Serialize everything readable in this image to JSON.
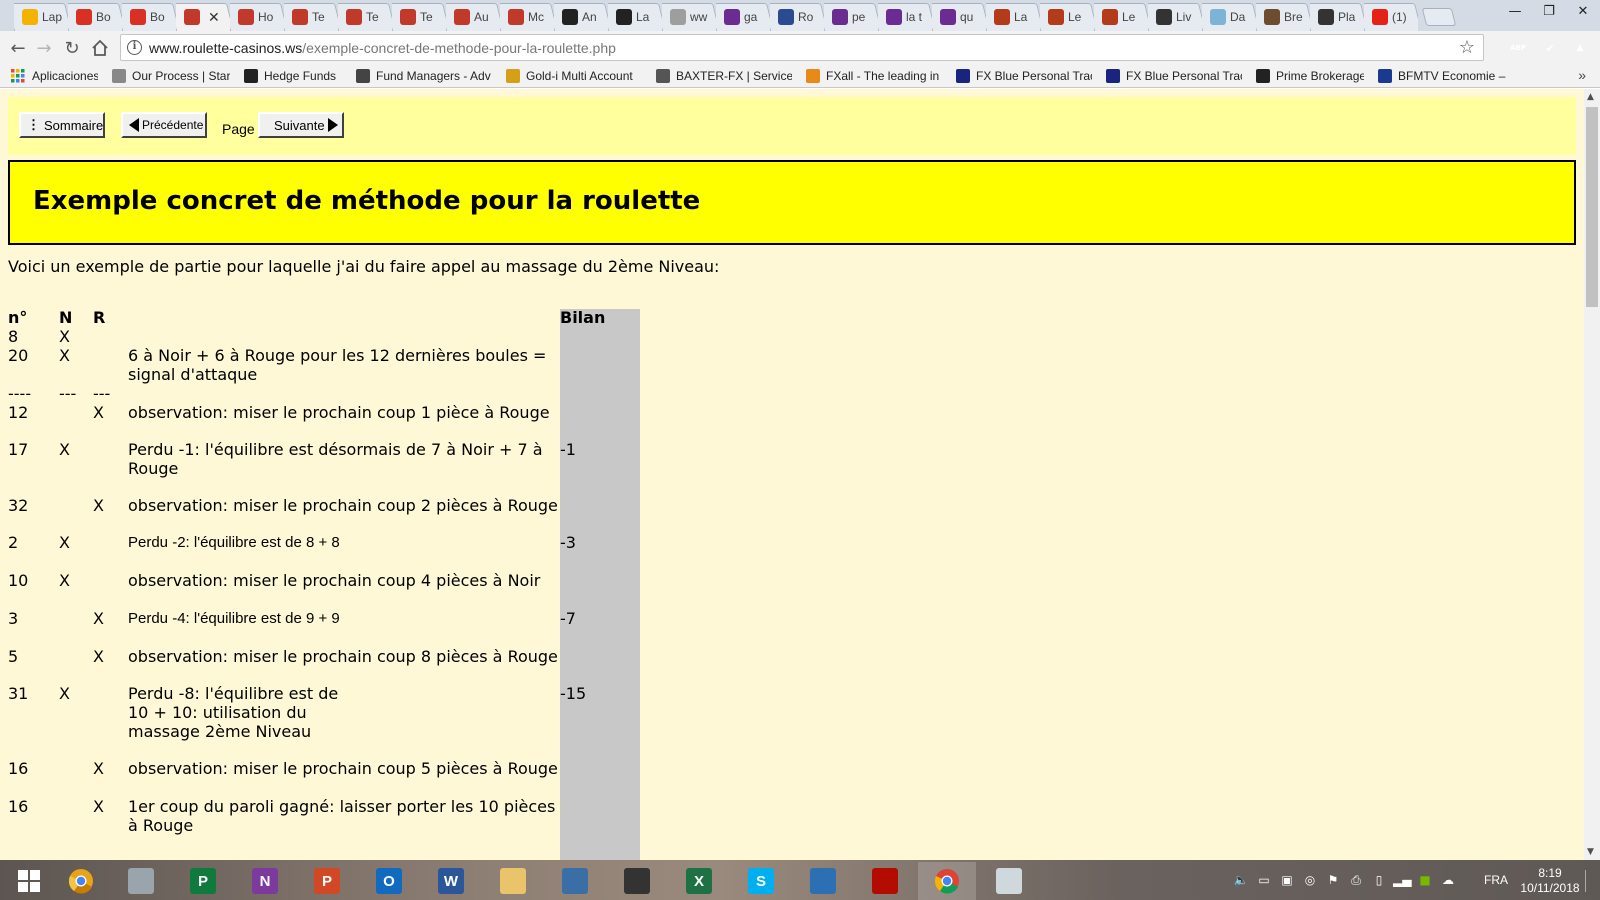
{
  "browser": {
    "tabs": [
      {
        "label": "Lap",
        "icon": "lapin-icon",
        "color": "#f5b301"
      },
      {
        "label": "Bo",
        "icon": "gmail-icon",
        "color": "#d93025"
      },
      {
        "label": "Bo",
        "icon": "gmail-icon",
        "color": "#d93025"
      },
      {
        "label": "",
        "icon": "roulette-site-icon",
        "color": "#c0392b",
        "active": true
      },
      {
        "label": "Ho",
        "icon": "roulette-site-icon",
        "color": "#c0392b"
      },
      {
        "label": "Te",
        "icon": "roulette-site-icon",
        "color": "#c0392b"
      },
      {
        "label": "Te",
        "icon": "roulette-site-icon",
        "color": "#c0392b"
      },
      {
        "label": "Te",
        "icon": "roulette-site-icon",
        "color": "#c0392b"
      },
      {
        "label": "Au",
        "icon": "roulette-site-icon",
        "color": "#c0392b"
      },
      {
        "label": "Mc",
        "icon": "roulette-site-icon",
        "color": "#c0392b"
      },
      {
        "label": "An",
        "icon": "amazon-icon",
        "color": "#222222"
      },
      {
        "label": "La",
        "icon": "amazon-icon",
        "color": "#222222"
      },
      {
        "label": "ww",
        "icon": "page-icon",
        "color": "#9e9e9e"
      },
      {
        "label": "ga",
        "icon": "m-icon",
        "color": "#6b2c91"
      },
      {
        "label": "Ro",
        "icon": "sj-icon",
        "color": "#2c4a8f"
      },
      {
        "label": "pe",
        "icon": "m-icon",
        "color": "#6b2c91"
      },
      {
        "label": "la t",
        "icon": "m-icon",
        "color": "#6b2c91"
      },
      {
        "label": "qu",
        "icon": "m-icon",
        "color": "#6b2c91"
      },
      {
        "label": "La",
        "icon": "book-icon",
        "color": "#b33a1b"
      },
      {
        "label": "Le",
        "icon": "book-icon",
        "color": "#b33a1b"
      },
      {
        "label": "Le",
        "icon": "book-icon",
        "color": "#b33a1b"
      },
      {
        "label": "Liv",
        "icon": "plus-icon",
        "color": "#333333"
      },
      {
        "label": "Da",
        "icon": "cloud-icon",
        "color": "#7fb3d5"
      },
      {
        "label": "Bre",
        "icon": "game-icon",
        "color": "#6d4c2f"
      },
      {
        "label": "Pla",
        "icon": "photo-icon",
        "color": "#333333"
      },
      {
        "label": "(1)",
        "icon": "youtube-icon",
        "color": "#e62117"
      }
    ],
    "url_domain": "www.roulette-casinos.ws",
    "url_path": "/exemple-concret-de-methode-pour-la-roulette.php",
    "extensions": [
      {
        "label": "ABP",
        "color": "#c70d2c"
      },
      {
        "label": "✔",
        "color": "#2eb34a"
      },
      {
        "label": "▲",
        "color": "#d9341a"
      }
    ],
    "bookmarks": [
      {
        "label": "Aplicaciones",
        "icon": "apps-icon"
      },
      {
        "label": "Our Process | Start a",
        "icon": "page-icon"
      },
      {
        "label": "Hedge Funds",
        "icon": "sh-icon"
      },
      {
        "label": "Fund Managers - Adv",
        "icon": "w-icon"
      },
      {
        "label": "Gold-i Multi Account",
        "icon": "goldi-icon"
      },
      {
        "label": "BAXTER-FX | Services",
        "icon": "baxter-icon"
      },
      {
        "label": "FXall - The leading in",
        "icon": "fxall-icon"
      },
      {
        "label": "FX Blue Personal Trac",
        "icon": "fxblue-icon"
      },
      {
        "label": "FX Blue Personal Trac",
        "icon": "fxblue-icon"
      },
      {
        "label": "Prime Brokerage",
        "icon": "prime-icon"
      },
      {
        "label": "BFMTV Economie – la",
        "icon": "bfm-icon"
      }
    ]
  },
  "page": {
    "nav": {
      "sommaire": "Sommaire",
      "precedente": "Précédente",
      "page": "Page",
      "suivante": "Suivante"
    },
    "title": "Exemple concret de méthode pour la roulette",
    "intro": "Voici un exemple de partie pour laquelle j'ai du faire appel au massage du 2ème Niveau:",
    "table": {
      "headers": {
        "no": "n°",
        "n": "N",
        "r": "R",
        "bilan": "Bilan"
      },
      "rows": [
        {
          "no": "8",
          "n": "X",
          "r": "",
          "comment": "",
          "bilan": ""
        },
        {
          "no": "20",
          "n": "X",
          "r": "",
          "comment": "6 à Noir + 6 à Rouge pour les 12 dernières boules = signal d'attaque",
          "bilan": ""
        },
        {
          "no": "----",
          "n": "---",
          "r": "---",
          "comment": "",
          "bilan": ""
        },
        {
          "no": "12",
          "n": "",
          "r": "X",
          "comment": "observation: miser le prochain coup 1 pièce à Rouge",
          "bilan": ""
        },
        {
          "no": "17",
          "n": "X",
          "r": "",
          "comment": "Perdu -1: l'équilibre est désormais de 7 à Noir + 7 à Rouge",
          "bilan": "-1"
        },
        {
          "no": "32",
          "n": "",
          "r": "X",
          "comment": "observation: miser le prochain coup 2 pièces à Rouge",
          "bilan": ""
        },
        {
          "no": "2",
          "n": "X",
          "r": "",
          "comment": "Perdu -2: l'équilibre est de 8 + 8",
          "bilan": "-3"
        },
        {
          "no": "10",
          "n": "X",
          "r": "",
          "comment": "observation: miser le prochain coup 4 pièces à Noir",
          "bilan": ""
        },
        {
          "no": "3",
          "n": "",
          "r": "X",
          "comment": "Perdu -4: l'équilibre est de 9 + 9",
          "bilan": "-7"
        },
        {
          "no": "5",
          "n": "",
          "r": "X",
          "comment": "observation: miser le prochain coup 8 pièces à Rouge",
          "bilan": ""
        },
        {
          "no": "31",
          "n": "X",
          "r": "",
          "comment_lines": [
            "Perdu -8: l'équilibre est de",
            "10 + 10: utilisation du",
            "massage 2ème Niveau"
          ],
          "bilan": "-15"
        },
        {
          "no": "16",
          "n": "",
          "r": "X",
          "comment": "observation: miser le prochain coup 5 pièces à Rouge",
          "bilan": ""
        },
        {
          "no": "16",
          "n": "",
          "r": "X",
          "comment": "1er coup du paroli gagné: laisser porter les 10 pièces à Rouge",
          "bilan": ""
        }
      ]
    }
  },
  "taskbar": {
    "apps": [
      {
        "name": "start-button",
        "icon": "windows-icon",
        "color": "#ffffff",
        "glyph": ""
      },
      {
        "name": "taskbar-chrome-canary",
        "icon": "chrome-canary-icon",
        "color": "#e8a317",
        "glyph": ""
      },
      {
        "name": "taskbar-notepad",
        "icon": "notepad-icon",
        "color": "#9aa4ad",
        "glyph": ""
      },
      {
        "name": "taskbar-publisher",
        "icon": "publisher-icon",
        "color": "#0e7a3c",
        "glyph": "P"
      },
      {
        "name": "taskbar-onenote",
        "icon": "onenote-icon",
        "color": "#7c3a9d",
        "glyph": "N"
      },
      {
        "name": "taskbar-powerpoint",
        "icon": "powerpoint-icon",
        "color": "#d24726",
        "glyph": "P"
      },
      {
        "name": "taskbar-outlook",
        "icon": "outlook-icon",
        "color": "#0f6ac0",
        "glyph": "O"
      },
      {
        "name": "taskbar-word",
        "icon": "word-icon",
        "color": "#2b579a",
        "glyph": "W"
      },
      {
        "name": "taskbar-explorer",
        "icon": "folder-icon",
        "color": "#e9c46a",
        "glyph": ""
      },
      {
        "name": "taskbar-owl-app",
        "icon": "owl-icon",
        "color": "#3a6ea5",
        "glyph": ""
      },
      {
        "name": "taskbar-owl-app-2",
        "icon": "owl-dark-icon",
        "color": "#333333",
        "glyph": ""
      },
      {
        "name": "taskbar-excel",
        "icon": "excel-icon",
        "color": "#1e7145",
        "glyph": "X"
      },
      {
        "name": "taskbar-skype",
        "icon": "skype-icon",
        "color": "#00aff0",
        "glyph": "S"
      },
      {
        "name": "taskbar-remote-app",
        "icon": "remote-icon",
        "color": "#2d6fb3",
        "glyph": ""
      },
      {
        "name": "taskbar-acrobat",
        "icon": "acrobat-icon",
        "color": "#b30b00",
        "glyph": ""
      },
      {
        "name": "taskbar-chrome",
        "icon": "chrome-icon",
        "color": "#4285f4",
        "glyph": "",
        "active": true
      },
      {
        "name": "taskbar-paint",
        "icon": "paint-icon",
        "color": "#cfd8dc",
        "glyph": ""
      }
    ],
    "language": "FRA",
    "time": "8:19",
    "date": "10/11/2018"
  }
}
